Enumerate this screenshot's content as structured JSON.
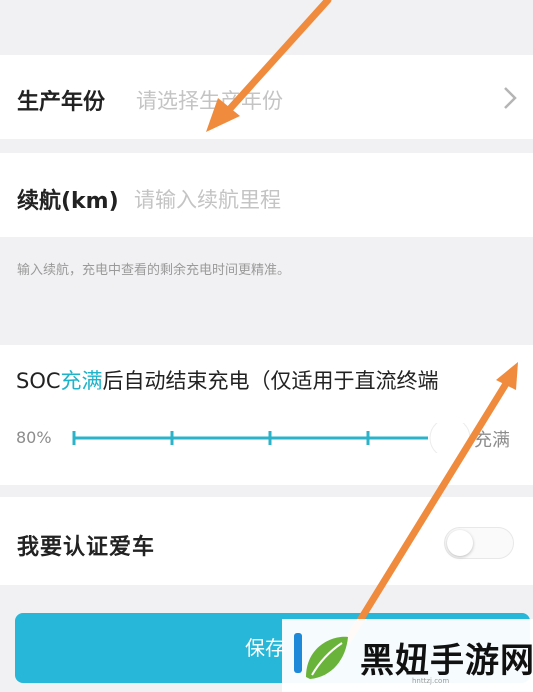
{
  "production_year": {
    "label": "生产年份",
    "placeholder": "请选择生产年份"
  },
  "range": {
    "label": "续航(km)",
    "placeholder": "请输入续航里程",
    "hint": "输入续航，充电中查看的剩余充电时间更精准。"
  },
  "soc": {
    "title_prefix": "SOC",
    "title_accent": "充满",
    "title_suffix": "后自动结束充电（仅适用于直流终端",
    "min_label": "80%",
    "max_label": "充满",
    "slider_value_fraction": 1.0,
    "tick_count": 5
  },
  "verify_car": {
    "label": "我要认证爱车",
    "toggle_on": false
  },
  "save": {
    "label": "保存"
  },
  "watermark": {
    "text": "黑妞手游网",
    "url": "hnttzj.com"
  },
  "colors": {
    "accent": "#1fb3c9",
    "button": "#27b7d8",
    "annotation_arrow": "#f08a3c"
  }
}
